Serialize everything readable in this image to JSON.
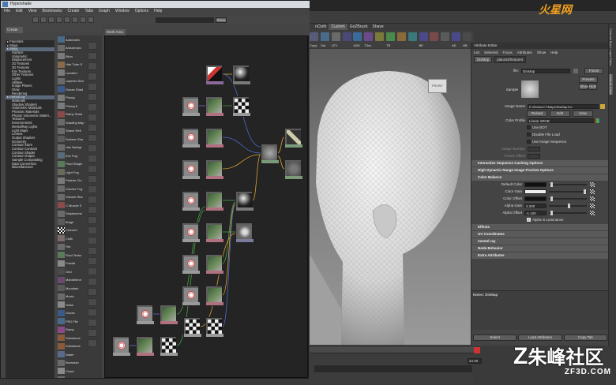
{
  "hypershade": {
    "title": "Hypershade",
    "menu": [
      "File",
      "Edit",
      "View",
      "Bookmarks",
      "Create",
      "Tabs",
      "Graph",
      "Window",
      "Options",
      "Help"
    ],
    "create_tab": "Create",
    "show_label": "Show",
    "work_area_tab": "Work Area",
    "tree": [
      {
        "label": "Favorites",
        "level": 0
      },
      {
        "label": "Maya",
        "level": 0
      },
      {
        "label": "Maya",
        "level": 0,
        "hl": true
      },
      {
        "label": "Surface",
        "level": 1
      },
      {
        "label": "Volumetric",
        "level": 1
      },
      {
        "label": "Displacement",
        "level": 1
      },
      {
        "label": "2D Textures",
        "level": 1
      },
      {
        "label": "3D Textures",
        "level": 1
      },
      {
        "label": "Env Textures",
        "level": 1
      },
      {
        "label": "Other Textures",
        "level": 1
      },
      {
        "label": "Lights",
        "level": 1
      },
      {
        "label": "Utilities",
        "level": 1
      },
      {
        "label": "Image Planes",
        "level": 1
      },
      {
        "label": "Glow",
        "level": 1
      },
      {
        "label": "Rendering",
        "level": 1
      },
      {
        "label": "mental ray",
        "level": 0,
        "hl": true
      },
      {
        "label": "Materials",
        "level": 1
      },
      {
        "label": "Shadow Shaders",
        "level": 1
      },
      {
        "label": "Volumetric Materials",
        "level": 1
      },
      {
        "label": "Photonic Materials",
        "level": 1
      },
      {
        "label": "Photon Volumetric Materi...",
        "level": 1
      },
      {
        "label": "Textures",
        "level": 1
      },
      {
        "label": "Environments",
        "level": 1
      },
      {
        "label": "MentalRay Lights",
        "level": 1
      },
      {
        "label": "Light Maps",
        "level": 1
      },
      {
        "label": "Lenses",
        "level": 1
      },
      {
        "label": "Output Shaders",
        "level": 1
      },
      {
        "label": "Geometry",
        "level": 1
      },
      {
        "label": "Contour Store",
        "level": 1
      },
      {
        "label": "Contour Contrast",
        "level": 1
      },
      {
        "label": "Contour Shader",
        "level": 1
      },
      {
        "label": "Contour Output",
        "level": 1
      },
      {
        "label": "Sample Compositing",
        "level": 1
      },
      {
        "label": "Data Conversion",
        "level": 1
      },
      {
        "label": "Miscellaneous",
        "level": 1
      }
    ],
    "node_types": [
      {
        "label": "Addmatrix",
        "color": "#4a6a8a"
      },
      {
        "label": "Anisotropic",
        "color": "#6a6a6a"
      },
      {
        "label": "Blinn",
        "color": "#7a7a7a"
      },
      {
        "label": "Hair Tube S",
        "color": "#8a6a4a"
      },
      {
        "label": "Lambert",
        "color": "#7a7a7a"
      },
      {
        "label": "Layered Sha",
        "color": "#6a6a6a"
      },
      {
        "label": "Ocean Shad",
        "color": "#3a5a8a"
      },
      {
        "label": "Phong",
        "color": "#7a7a7a"
      },
      {
        "label": "Phong E",
        "color": "#7a7a7a"
      },
      {
        "label": "Ramp Shad",
        "color": "#8a4a4a"
      },
      {
        "label": "Shading Map",
        "color": "#6a6a6a"
      },
      {
        "label": "Shave Refl",
        "color": "#6a6a6a"
      },
      {
        "label": "Surface Sha",
        "color": "#5a5a5a"
      },
      {
        "label": "Use Backgr",
        "color": "#6a6a6a"
      },
      {
        "label": "Env Fog",
        "color": "#5a6a7a"
      },
      {
        "label": "Fluid Shape",
        "color": "#5a7a5a"
      },
      {
        "label": "Light Fog",
        "color": "#6a6a5a"
      },
      {
        "label": "Particle Clo",
        "color": "#7a7a7a"
      },
      {
        "label": "Volume Fog",
        "color": "#6a6a6a"
      },
      {
        "label": "Volume Sha",
        "color": "#6a6a6a"
      },
      {
        "label": "C Muscle S",
        "color": "#8a4a4a"
      },
      {
        "label": "Displaceme",
        "color": "#6a6a6a"
      },
      {
        "label": "Bulge",
        "color": "#5a5a5a"
      },
      {
        "label": "Checker",
        "color": "#eeeeee"
      },
      {
        "label": "Cloth",
        "color": "#7a6a6a"
      },
      {
        "label": "File",
        "color": "#6a6a6a"
      },
      {
        "label": "Fluid Textur",
        "color": "#5a7a5a"
      },
      {
        "label": "Fractal",
        "color": "#8a8a8a"
      },
      {
        "label": "Grid",
        "color": "#4a4a4a"
      },
      {
        "label": "Mandelbrot",
        "color": "#6a4a6a"
      },
      {
        "label": "Mountain",
        "color": "#5a5a5a"
      },
      {
        "label": "Movie",
        "color": "#6a6a6a"
      },
      {
        "label": "Noise",
        "color": "#8a8a8a"
      },
      {
        "label": "Ocean",
        "color": "#3a5a8a"
      },
      {
        "label": "PSD File",
        "color": "#4a6a8a"
      },
      {
        "label": "Ramp",
        "color": "#8a4a8a"
      },
      {
        "label": "Substance",
        "color": "#8a5a3a"
      },
      {
        "label": "Substance",
        "color": "#8a5a3a"
      },
      {
        "label": "Water",
        "color": "#5a6a8a"
      },
      {
        "label": "Brownian",
        "color": "#6a6a6a"
      },
      {
        "label": "Cloud",
        "color": "#8a8a8a"
      },
      {
        "label": "Crater",
        "color": "#6a6a6a"
      }
    ]
  },
  "maya": {
    "shelf_tabs": [
      "nCloth",
      "Custom",
      "GoZBrush",
      "Shave"
    ],
    "active_shelf_tab": "Custom",
    "shelf_items": [
      {
        "label": "Copy",
        "color": "#5a5a7a"
      },
      {
        "label": "Out",
        "color": "#4a6a8a"
      },
      {
        "label": "UT1",
        "color": "#6a6a6a"
      },
      {
        "label": "",
        "color": "#4a4a7a"
      },
      {
        "label": "UDK",
        "color": "#3a6a9a"
      },
      {
        "label": "T3ov",
        "color": "#6a4a8a"
      },
      {
        "label": "",
        "color": "#7a7a3a"
      },
      {
        "label": "TR",
        "color": "#4a8a4a"
      },
      {
        "label": "",
        "color": "#8a6a3a"
      },
      {
        "label": "",
        "color": "#3a7a7a"
      },
      {
        "label": "BE",
        "color": "#4a4a8a"
      },
      {
        "label": "",
        "color": "#7a4a4a"
      },
      {
        "label": "",
        "color": "#5a5a5a"
      },
      {
        "label": "AE",
        "color": "#4a4a8a"
      },
      {
        "label": "HB",
        "color": "#4a4a4a"
      }
    ],
    "viewcube_label": "FRONT",
    "timeline": {
      "start": "24.00",
      "end": "48.00"
    },
    "watermark_top": "火星网",
    "watermark_bottom": "朱峰社区",
    "watermark_url": "ZF3D.COM"
  },
  "attribute_editor": {
    "title": "Attribute Editor",
    "menu": [
      "List",
      "Selected",
      "Focus",
      "Attributes",
      "Show",
      "Help"
    ],
    "tabs": [
      "DisMap",
      "place2dTexture4"
    ],
    "file_label": "file:",
    "file_value": "DisMap",
    "focus_label": "Focus",
    "presets_label": "Presets",
    "show_label": "Show",
    "hide_label": "Hide",
    "sample_label": "Sample",
    "image_name_label": "Image Name",
    "image_name_value": "E:\\Works\\CT\\Maps\\DisMap.tex",
    "reload_label": "Reload",
    "edit_label": "Edit",
    "view_label": "View",
    "color_profile_label": "Color Profile",
    "color_profile_value": "Linear sRGB",
    "checks": [
      {
        "label": "Use BOT",
        "checked": false
      },
      {
        "label": "Disable File Load",
        "checked": false
      },
      {
        "label": "Use Image Sequence",
        "checked": false
      }
    ],
    "image_number_label": "Image Number",
    "frame_offset_label": "Frame Offset",
    "sections": [
      "Interactive Sequence Caching Options",
      "High Dynamic Range Image Preview Options",
      "Color Balance"
    ],
    "color_balance": [
      {
        "label": "Default Color",
        "value": "",
        "swatch": "#111111"
      },
      {
        "label": "Color Gain",
        "value": "",
        "swatch": "#eeeeee"
      },
      {
        "label": "Color Offset",
        "value": "",
        "swatch": "#111111"
      },
      {
        "label": "Alpha Gain",
        "value": "2.200",
        "swatch": ""
      },
      {
        "label": "Alpha Offset",
        "value": "-1.100",
        "swatch": ""
      }
    ],
    "alpha_luminance_label": "Alpha Is Luminance",
    "more_sections": [
      "Effects",
      "UV Coordinates",
      "mental ray",
      "Node Behavior",
      "Extra Attributes"
    ],
    "notes_label": "Notes: DisMap",
    "bottom_buttons": [
      "Select",
      "Load Attributes",
      "Copy Tab"
    ]
  },
  "channel_box": {
    "labels": [
      "Channel Box / Layer Editor",
      "Attribute Editor"
    ]
  }
}
